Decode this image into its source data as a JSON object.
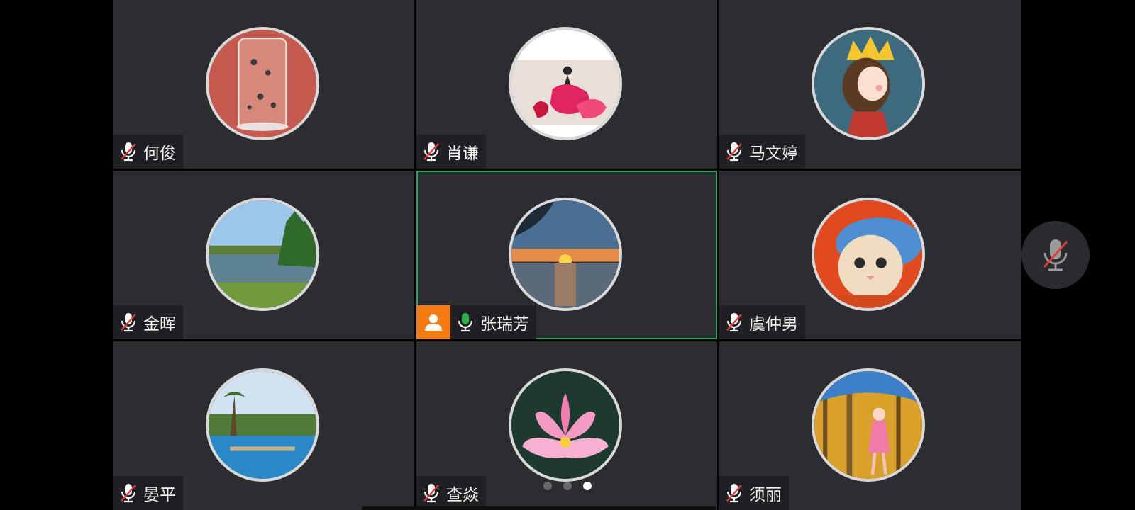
{
  "participants": [
    {
      "name": "何俊",
      "mic": "muted",
      "avatar_theme": "tea-glass"
    },
    {
      "name": "肖谦",
      "mic": "muted",
      "avatar_theme": "ballerina"
    },
    {
      "name": "马文婷",
      "mic": "muted",
      "avatar_theme": "crown-girl"
    },
    {
      "name": "金晖",
      "mic": "muted",
      "avatar_theme": "lake"
    },
    {
      "name": "张瑞芳",
      "mic": "active",
      "avatar_theme": "sunset",
      "is_host": true,
      "speaking": true
    },
    {
      "name": "虞仲男",
      "mic": "muted",
      "avatar_theme": "cat-fish"
    },
    {
      "name": "晏平",
      "mic": "muted",
      "avatar_theme": "pool"
    },
    {
      "name": "查焱",
      "mic": "muted",
      "avatar_theme": "lotus"
    },
    {
      "name": "须丽",
      "mic": "muted",
      "avatar_theme": "forest-girl"
    }
  ],
  "pagination": {
    "pages": 3,
    "current": 3
  },
  "controls": {
    "mic_button_state": "muted"
  },
  "colors": {
    "tile_bg": "#2c2d30",
    "speaking_border": "#1fa85a",
    "host_badge": "#f27a12",
    "mic_active": "#2bb24c",
    "mic_muted_slash": "#e43b3b"
  },
  "icons": {
    "mic_muted": "mic-muted-icon",
    "mic_active": "mic-icon",
    "host": "person-icon"
  }
}
